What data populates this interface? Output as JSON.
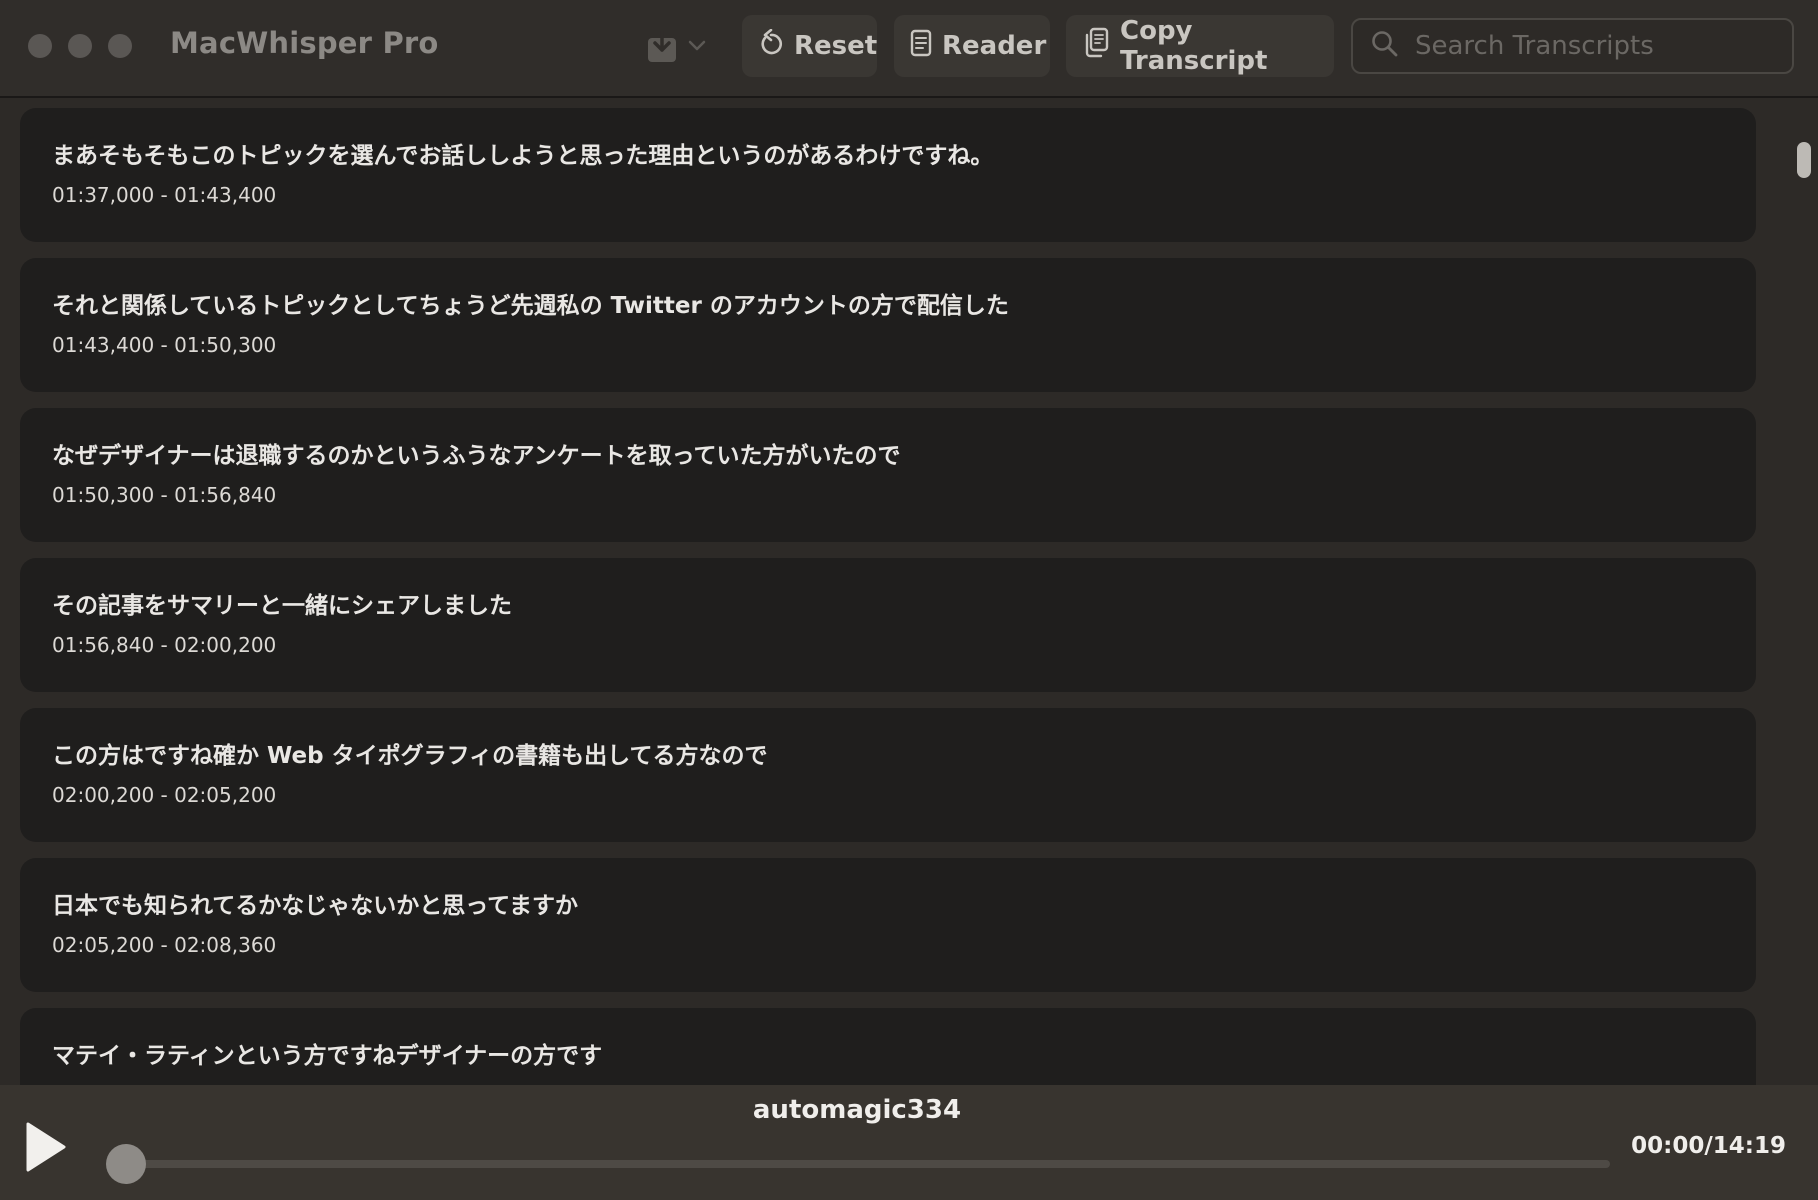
{
  "window": {
    "title": "MacWhisper Pro"
  },
  "toolbar": {
    "reset_label": "Reset",
    "reader_label": "Reader",
    "copy_label": "Copy Transcript"
  },
  "search": {
    "placeholder": "Search Transcripts",
    "value": ""
  },
  "segments": [
    {
      "text": "まあそもそもこのトピックを選んでお話ししようと思った理由というのがあるわけですね。",
      "time": "01:37,000 - 01:43,400"
    },
    {
      "text": "それと関係しているトピックとしてちょうど先週私の Twitter のアカウントの方で配信した",
      "time": "01:43,400 - 01:50,300"
    },
    {
      "text": "なぜデザイナーは退職するのかというふうなアンケートを取っていた方がいたので",
      "time": "01:50,300 - 01:56,840"
    },
    {
      "text": "その記事をサマリーと一緒にシェアしました",
      "time": "01:56,840 - 02:00,200"
    },
    {
      "text": "この方はですね確か Web タイポグラフィの書籍も出してる方なので",
      "time": "02:00,200 - 02:05,200"
    },
    {
      "text": "日本でも知られてるかなじゃないかと思ってますか",
      "time": "02:05,200 - 02:08,360"
    },
    {
      "text": "マテイ・ラティンという方ですねデザイナーの方です",
      "time": ""
    }
  ],
  "player": {
    "track_name": "automagic334",
    "time_readout": "00:00/14:19",
    "progress": 0
  },
  "icons": {
    "export": "export-tray-icon",
    "chevron": "chevron-down-icon",
    "reset": "reset-arrow-icon",
    "reader": "document-icon",
    "copy": "copy-documents-icon",
    "search": "search-icon",
    "play": "play-icon"
  }
}
